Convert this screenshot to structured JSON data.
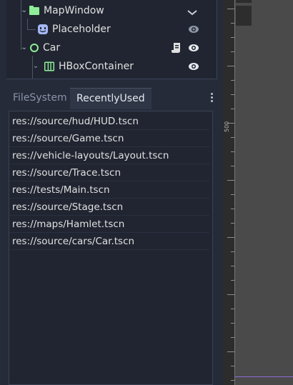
{
  "scene_tree": {
    "nodes": [
      {
        "label": "MapWindow",
        "icon": "folder-icon",
        "right_icon": "collapse-chevron-icon"
      },
      {
        "label": "Placeholder",
        "icon": "sprite-face-icon",
        "right_icon": "visibility-eye-icon"
      },
      {
        "label": "Car",
        "icon": "node2d-circle-icon",
        "right_icon": "visibility-eye-icon",
        "extra_icon": "script-icon"
      },
      {
        "label": "HBoxContainer",
        "icon": "hbox-container-icon",
        "right_icon": "visibility-eye-icon"
      }
    ]
  },
  "dock": {
    "tabs": [
      {
        "label": "FileSystem",
        "active": false
      },
      {
        "label": "RecentlyUsed",
        "active": true
      }
    ],
    "menu_icon": "kebab-menu-icon"
  },
  "recent_files": [
    "res://source/hud/HUD.tscn",
    "res://source/Game.tscn",
    "res://vehicle-layouts/Layout.tscn",
    "res://source/Trace.tscn",
    "res://tests/Main.tscn",
    "res://source/Stage.tscn",
    "res://maps/Hamlet.tscn",
    "res://source/cars/Car.tscn"
  ],
  "viewport": {
    "ruler_label": "500"
  },
  "colors": {
    "accent_green": "#8eef97",
    "accent_blue": "#a5b7f3",
    "selection_purple": "#8b6bd6"
  }
}
